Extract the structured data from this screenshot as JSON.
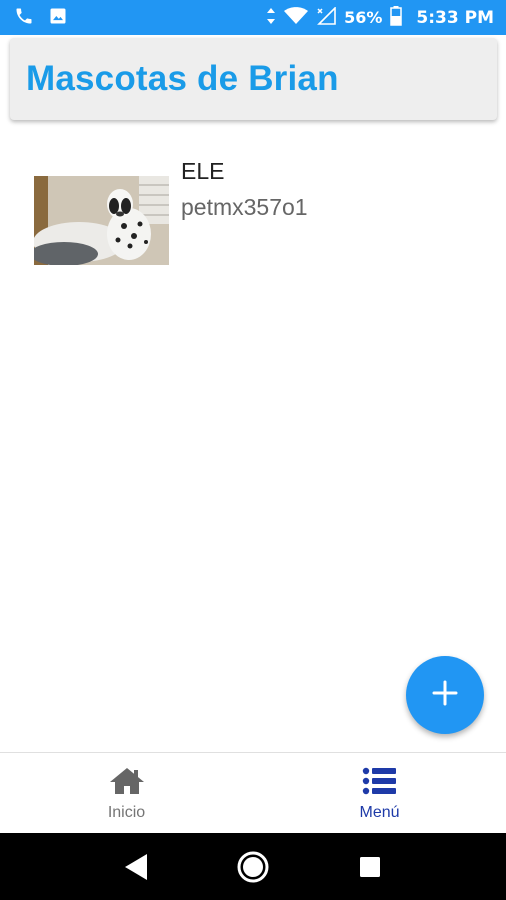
{
  "status_bar": {
    "icons": [
      "phone-icon",
      "image-icon",
      "data-arrows-icon",
      "wifi-icon",
      "signal-icon",
      "battery-icon"
    ],
    "battery_percent": "56%",
    "time": "5:33 PM",
    "background": "#2196f3"
  },
  "app_bar": {
    "title": "Mascotas de  Brian",
    "title_color": "#1a9be8"
  },
  "pets": [
    {
      "name": "ELE",
      "code": "petmx357o1",
      "photo": "dalmatian dog on bed"
    }
  ],
  "fab": {
    "icon": "plus-icon",
    "color": "#2196f3"
  },
  "bottom_nav": {
    "items": [
      {
        "label": "Inicio",
        "icon": "home-icon",
        "active": false
      },
      {
        "label": "Menú",
        "icon": "list-icon",
        "active": true
      }
    ],
    "active_color": "#1e3aa8"
  },
  "system_nav": {
    "icons": [
      "back-icon",
      "home-circle-icon",
      "recents-icon"
    ]
  }
}
